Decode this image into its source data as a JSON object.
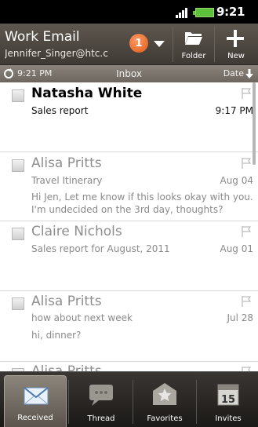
{
  "status_bar": {
    "time": "9:21",
    "ampm": "PM"
  },
  "header": {
    "account_title": "Work Email",
    "account_email": "Jennifer_Singer@htc.c",
    "unread_badge": "1",
    "folder_label": "Folder",
    "new_label": "New"
  },
  "subbar": {
    "sync_time": "9:21 PM",
    "folder": "Inbox",
    "sort": "Date"
  },
  "messages": [
    {
      "sender": "Natasha White",
      "subject": "Sales report",
      "date": "9:17 PM",
      "preview": "",
      "unread": true
    },
    {
      "sender": "Alisa Pritts",
      "subject": "Travel Itinerary",
      "date": "Aug 04",
      "preview": "Hi Jen, Let me know if this looks okay with you. I'm undecided on the 3rd day, thoughts?",
      "unread": false
    },
    {
      "sender": "Claire Nichols",
      "subject": "Sales report for August, 2011",
      "date": "Aug 01",
      "preview": "",
      "unread": false
    },
    {
      "sender": "Alisa Pritts",
      "subject": "how about next week",
      "date": "Jul 28",
      "preview": "hi, dinner?",
      "unread": false
    },
    {
      "sender": "Alisa Pritts",
      "subject": "",
      "date": "",
      "preview": "",
      "unread": false
    }
  ],
  "tabs": [
    {
      "label": "Received",
      "icon": "envelope-icon",
      "active": true
    },
    {
      "label": "Thread",
      "icon": "speech-bubble-icon",
      "active": false
    },
    {
      "label": "Favorites",
      "icon": "star-envelope-icon",
      "active": false
    },
    {
      "label": "Invites",
      "icon": "calendar-icon",
      "active": false,
      "day": "15"
    }
  ],
  "colors": {
    "header": "#4d4741",
    "subbar": "#7a746c",
    "badge": "#f07a3c",
    "battery": "#5cc03b"
  }
}
